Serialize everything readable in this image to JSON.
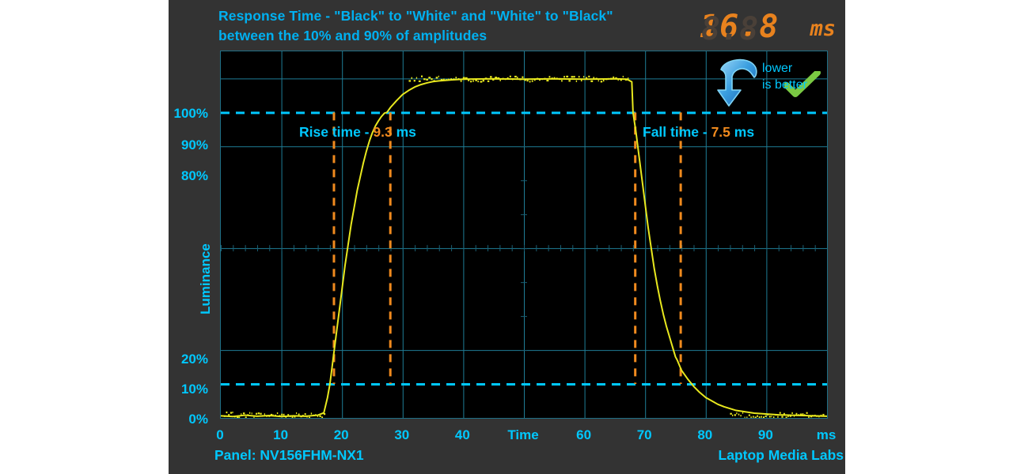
{
  "title": {
    "line1": "Response Time - \"Black\" to \"White\" and \"White\" to \"Black\"",
    "line2": "between the 10% and 90% of amplitudes"
  },
  "readout": {
    "value": "16.8",
    "unit": "ms",
    "ghost": "8.8",
    "color": "#e8821e"
  },
  "badge": {
    "line1": "lower",
    "line2": "is better",
    "arrow_icon": "curved-down-arrow",
    "check_icon": "green-check"
  },
  "annotations": {
    "rise": {
      "label": "Rise time -",
      "value": "9.3",
      "unit": "ms"
    },
    "fall": {
      "label": "Fall time -",
      "value": "7.5",
      "unit": "ms"
    }
  },
  "footer": {
    "panel": "Panel: NV156FHM-NX1",
    "source": "Laptop Media Labs"
  },
  "chart_data": {
    "type": "line",
    "title": "Response Time - \"Black\" to \"White\" and \"White\" to \"Black\" between the 10% and 90% of amplitudes",
    "xlabel": "Time",
    "ylabel": "Luminance",
    "xunit": "ms",
    "xlim": [
      0,
      100
    ],
    "ylim": [
      0,
      108
    ],
    "grid": true,
    "xticks": [
      0,
      10,
      20,
      30,
      40,
      50,
      60,
      70,
      80,
      90,
      100
    ],
    "xticklabels": [
      "0",
      "10",
      "20",
      "30",
      "40",
      "Time",
      "60",
      "70",
      "80",
      "90",
      "ms"
    ],
    "yticks": [
      0,
      10,
      20,
      80,
      90,
      100
    ],
    "yticklabels": [
      "0%",
      "10%",
      "20%",
      "80%",
      "90%",
      "100%"
    ],
    "series": [
      {
        "name": "Luminance",
        "color": "#e8e81e",
        "x": [
          0,
          2,
          4,
          6,
          8,
          10,
          12,
          14,
          16,
          17,
          17.6,
          18,
          18.5,
          19,
          19.5,
          20,
          20.5,
          21,
          21.5,
          22,
          22.5,
          23,
          23.5,
          24,
          24.5,
          25,
          25.5,
          26,
          26.5,
          27,
          27.4,
          28,
          29,
          30,
          31,
          32,
          33,
          34,
          35,
          36,
          38,
          40,
          45,
          50,
          55,
          60,
          65,
          67,
          67.8,
          68,
          68.5,
          69,
          69.5,
          70,
          70.5,
          71,
          71.5,
          72,
          72.5,
          73,
          73.5,
          74,
          74.5,
          75,
          75.3,
          76,
          77,
          78,
          79,
          80,
          81,
          82,
          83,
          85,
          88,
          92,
          96,
          100
        ],
        "y": [
          0.6,
          0.4,
          0.8,
          0.5,
          0.7,
          0.4,
          0.6,
          0.5,
          0.8,
          1.5,
          6,
          10,
          17,
          24,
          31,
          38,
          45,
          51,
          57,
          62,
          67,
          71,
          75,
          78.5,
          81.5,
          84,
          86,
          87.5,
          88.8,
          89.8,
          90,
          91.5,
          93.5,
          95.3,
          96.5,
          97.5,
          98.2,
          98.7,
          99.1,
          99.3,
          99.6,
          99.8,
          99.9,
          99.8,
          99.9,
          99.8,
          99.9,
          99.8,
          99,
          90,
          84,
          77,
          70,
          63,
          56,
          50,
          44,
          39,
          34.5,
          30.5,
          27,
          24,
          21,
          18,
          17,
          14,
          11.5,
          9.3,
          7.5,
          6,
          5,
          4,
          3.3,
          2.2,
          1.4,
          0.9,
          0.7,
          0.5
        ]
      }
    ],
    "markers": {
      "rise_start_x": 18.6,
      "rise_end_x": 27.9,
      "rise_duration_ms": 9.3,
      "fall_start_x": 68.3,
      "fall_end_x": 75.8,
      "fall_duration_ms": 7.5,
      "threshold_low_pct": 10,
      "threshold_high_pct": 90,
      "total_ms": 16.8
    },
    "colors": {
      "background": "#000000",
      "panel": "#333333",
      "grid": "#1f7d96",
      "accent_cyan": "#00c8ff",
      "accent_orange": "#f08a1e",
      "trace": "#e8e81e"
    }
  }
}
